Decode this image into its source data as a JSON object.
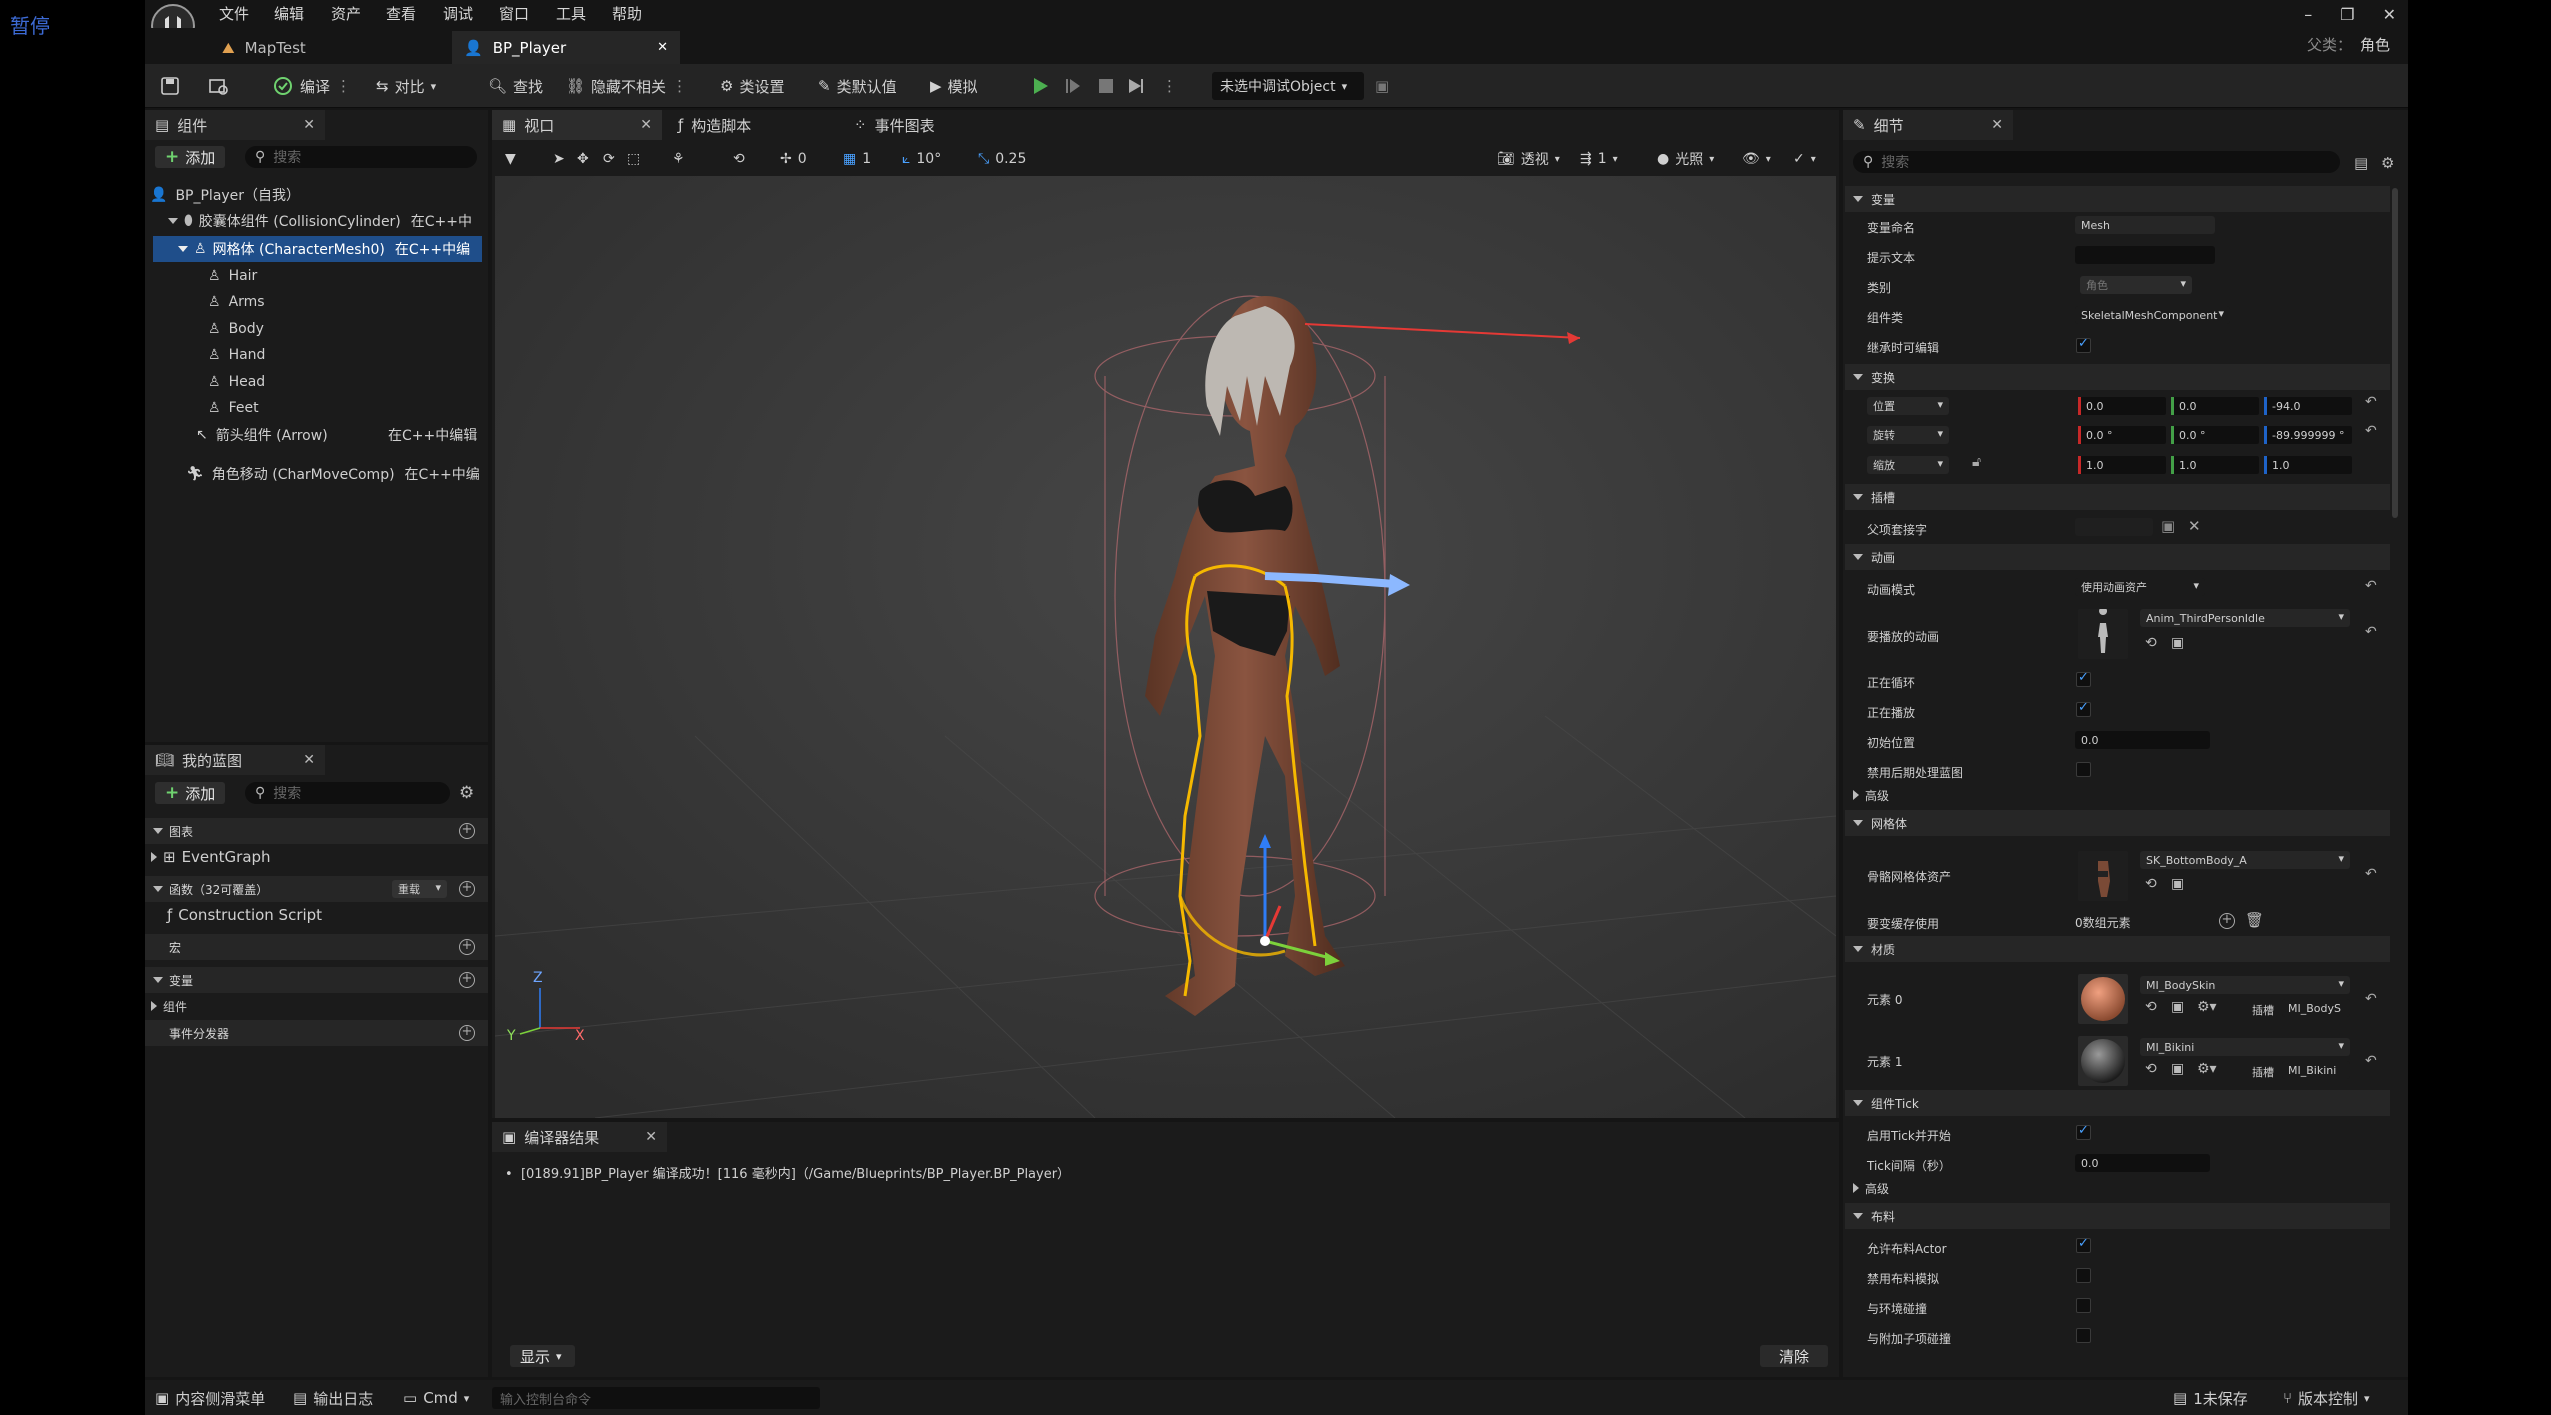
{
  "overlay": {
    "pause": "暂停"
  },
  "menu": [
    "文件",
    "编辑",
    "资产",
    "查看",
    "调试",
    "窗口",
    "工具",
    "帮助"
  ],
  "parent_class": {
    "label": "父类：",
    "value": "角色"
  },
  "tabs": [
    {
      "label": "MapTest"
    },
    {
      "label": "BP_Player"
    }
  ],
  "toolbar": {
    "compile": "编译",
    "diff": "对比",
    "find": "查找",
    "hide_unrelated": "隐藏不相关",
    "class_settings": "类设置",
    "class_defaults": "类默认值",
    "simulate": "模拟",
    "debug_object": "未选中调试Object"
  },
  "components_panel": {
    "title": "组件",
    "add": "添加",
    "search_placeholder": "搜索",
    "items": [
      {
        "name": "BP_Player（自我）",
        "note": ""
      },
      {
        "name": "胶囊体组件 (CollisionCylinder)",
        "note": "在C++中"
      },
      {
        "name": "网格体 (CharacterMesh0)",
        "note": "在C++中编"
      },
      {
        "name": "Hair",
        "note": ""
      },
      {
        "name": "Arms",
        "note": ""
      },
      {
        "name": "Body",
        "note": ""
      },
      {
        "name": "Hand",
        "note": ""
      },
      {
        "name": "Head",
        "note": ""
      },
      {
        "name": "Feet",
        "note": ""
      },
      {
        "name": "箭头组件 (Arrow)",
        "note": "在C++中编辑"
      },
      {
        "name": "角色移动 (CharMoveComp)",
        "note": "在C++中编"
      }
    ]
  },
  "my_blueprint": {
    "title": "我的蓝图",
    "add": "添加",
    "search_placeholder": "搜索",
    "graphs": "图表",
    "event_graph": "EventGraph",
    "functions": "函数（32可覆盖）",
    "override": "重载",
    "construction": "Construction Script",
    "macros": "宏",
    "variables": "变量",
    "components": "组件",
    "dispatchers": "事件分发器"
  },
  "viewport_tabs": [
    "视口",
    "构造脚本",
    "事件图表"
  ],
  "viewport_toolbar": {
    "rot_snap": "0",
    "grid": "1",
    "angle": "10°",
    "scale": "0.25",
    "perspective": "透视",
    "speed": "1",
    "lit": "光照"
  },
  "compiler": {
    "title": "编译器结果",
    "message": "[0189.91]BP_Player 编译成功！[116 毫秒内]（/Game/Blueprints/BP_Player.BP_Player）",
    "show": "显示",
    "clear": "清除"
  },
  "details": {
    "title": "细节",
    "search_placeholder": "搜索",
    "sections": {
      "variable": "变量",
      "transform": "变换",
      "sockets": "插槽",
      "animation": "动画",
      "advanced": "高级",
      "mesh": "网格体",
      "materials": "材质",
      "tick": "组件Tick",
      "advanced2": "高级",
      "cloth": "布料"
    },
    "var_name_label": "变量命名",
    "var_name": "Mesh",
    "tooltip_label": "提示文本",
    "category_label": "类别",
    "category": "角色",
    "component_class_label": "组件类",
    "component_class": "SkeletalMeshComponent",
    "editable_label": "继承时可编辑",
    "location_label": "位置",
    "location": [
      "0.0",
      "0.0",
      "-94.0"
    ],
    "rotation_label": "旋转",
    "rotation": [
      "0.0 °",
      "0.0 °",
      "-89.999999 °"
    ],
    "scale_label": "缩放",
    "scale": [
      "1.0",
      "1.0",
      "1.0"
    ],
    "parent_socket_label": "父项套接字",
    "anim_mode_label": "动画模式",
    "anim_mode": "使用动画资产",
    "anim_play_label": "要播放的动画",
    "anim_play": "Anim_ThirdPersonIdle",
    "looping_label": "正在循环",
    "playing_label": "正在播放",
    "initial_pos_label": "初始位置",
    "initial_pos": "0.0",
    "disable_post_label": "禁用后期处理蓝图",
    "skel_mesh_label": "骨骼网格体资产",
    "skel_mesh": "SK_BottomBody_A",
    "opt_label": "要变缓存使用",
    "opt_value": "0数组元素",
    "elem0_label": "元素 0",
    "elem0": "MI_BodySkin",
    "elem0_slot_label": "插槽",
    "elem0_slot": "MI_BodyS",
    "elem1_label": "元素 1",
    "elem1": "MI_Bikini",
    "elem1_slot_label": "插槽",
    "elem1_slot": "MI_Bikini",
    "tick_start_label": "启用Tick并开始",
    "tick_interval_label": "Tick间隔（秒）",
    "tick_interval": "0.0",
    "cloth_actor_label": "允许布料Actor",
    "cloth_sim_label": "禁用布料模拟",
    "env_collide_label": "与环境碰撞",
    "child_collide_label": "与附加子项碰撞"
  },
  "statusbar": {
    "content_drawer": "内容侧滑菜单",
    "output_log": "输出日志",
    "cmd": "Cmd",
    "console_placeholder": "输入控制台命令",
    "unsaved": "1未保存",
    "source_control": "版本控制"
  },
  "axes": {
    "x": "X",
    "y": "Y",
    "z": "Z"
  },
  "colors": {
    "accent": "#1f4e8a",
    "play": "#4caf50",
    "check": "#4aa1ff",
    "gizmo_x": "#e53935",
    "gizmo_y": "#7cd13b",
    "gizmo_z": "#2f7df6",
    "outline": "#f5b800"
  }
}
